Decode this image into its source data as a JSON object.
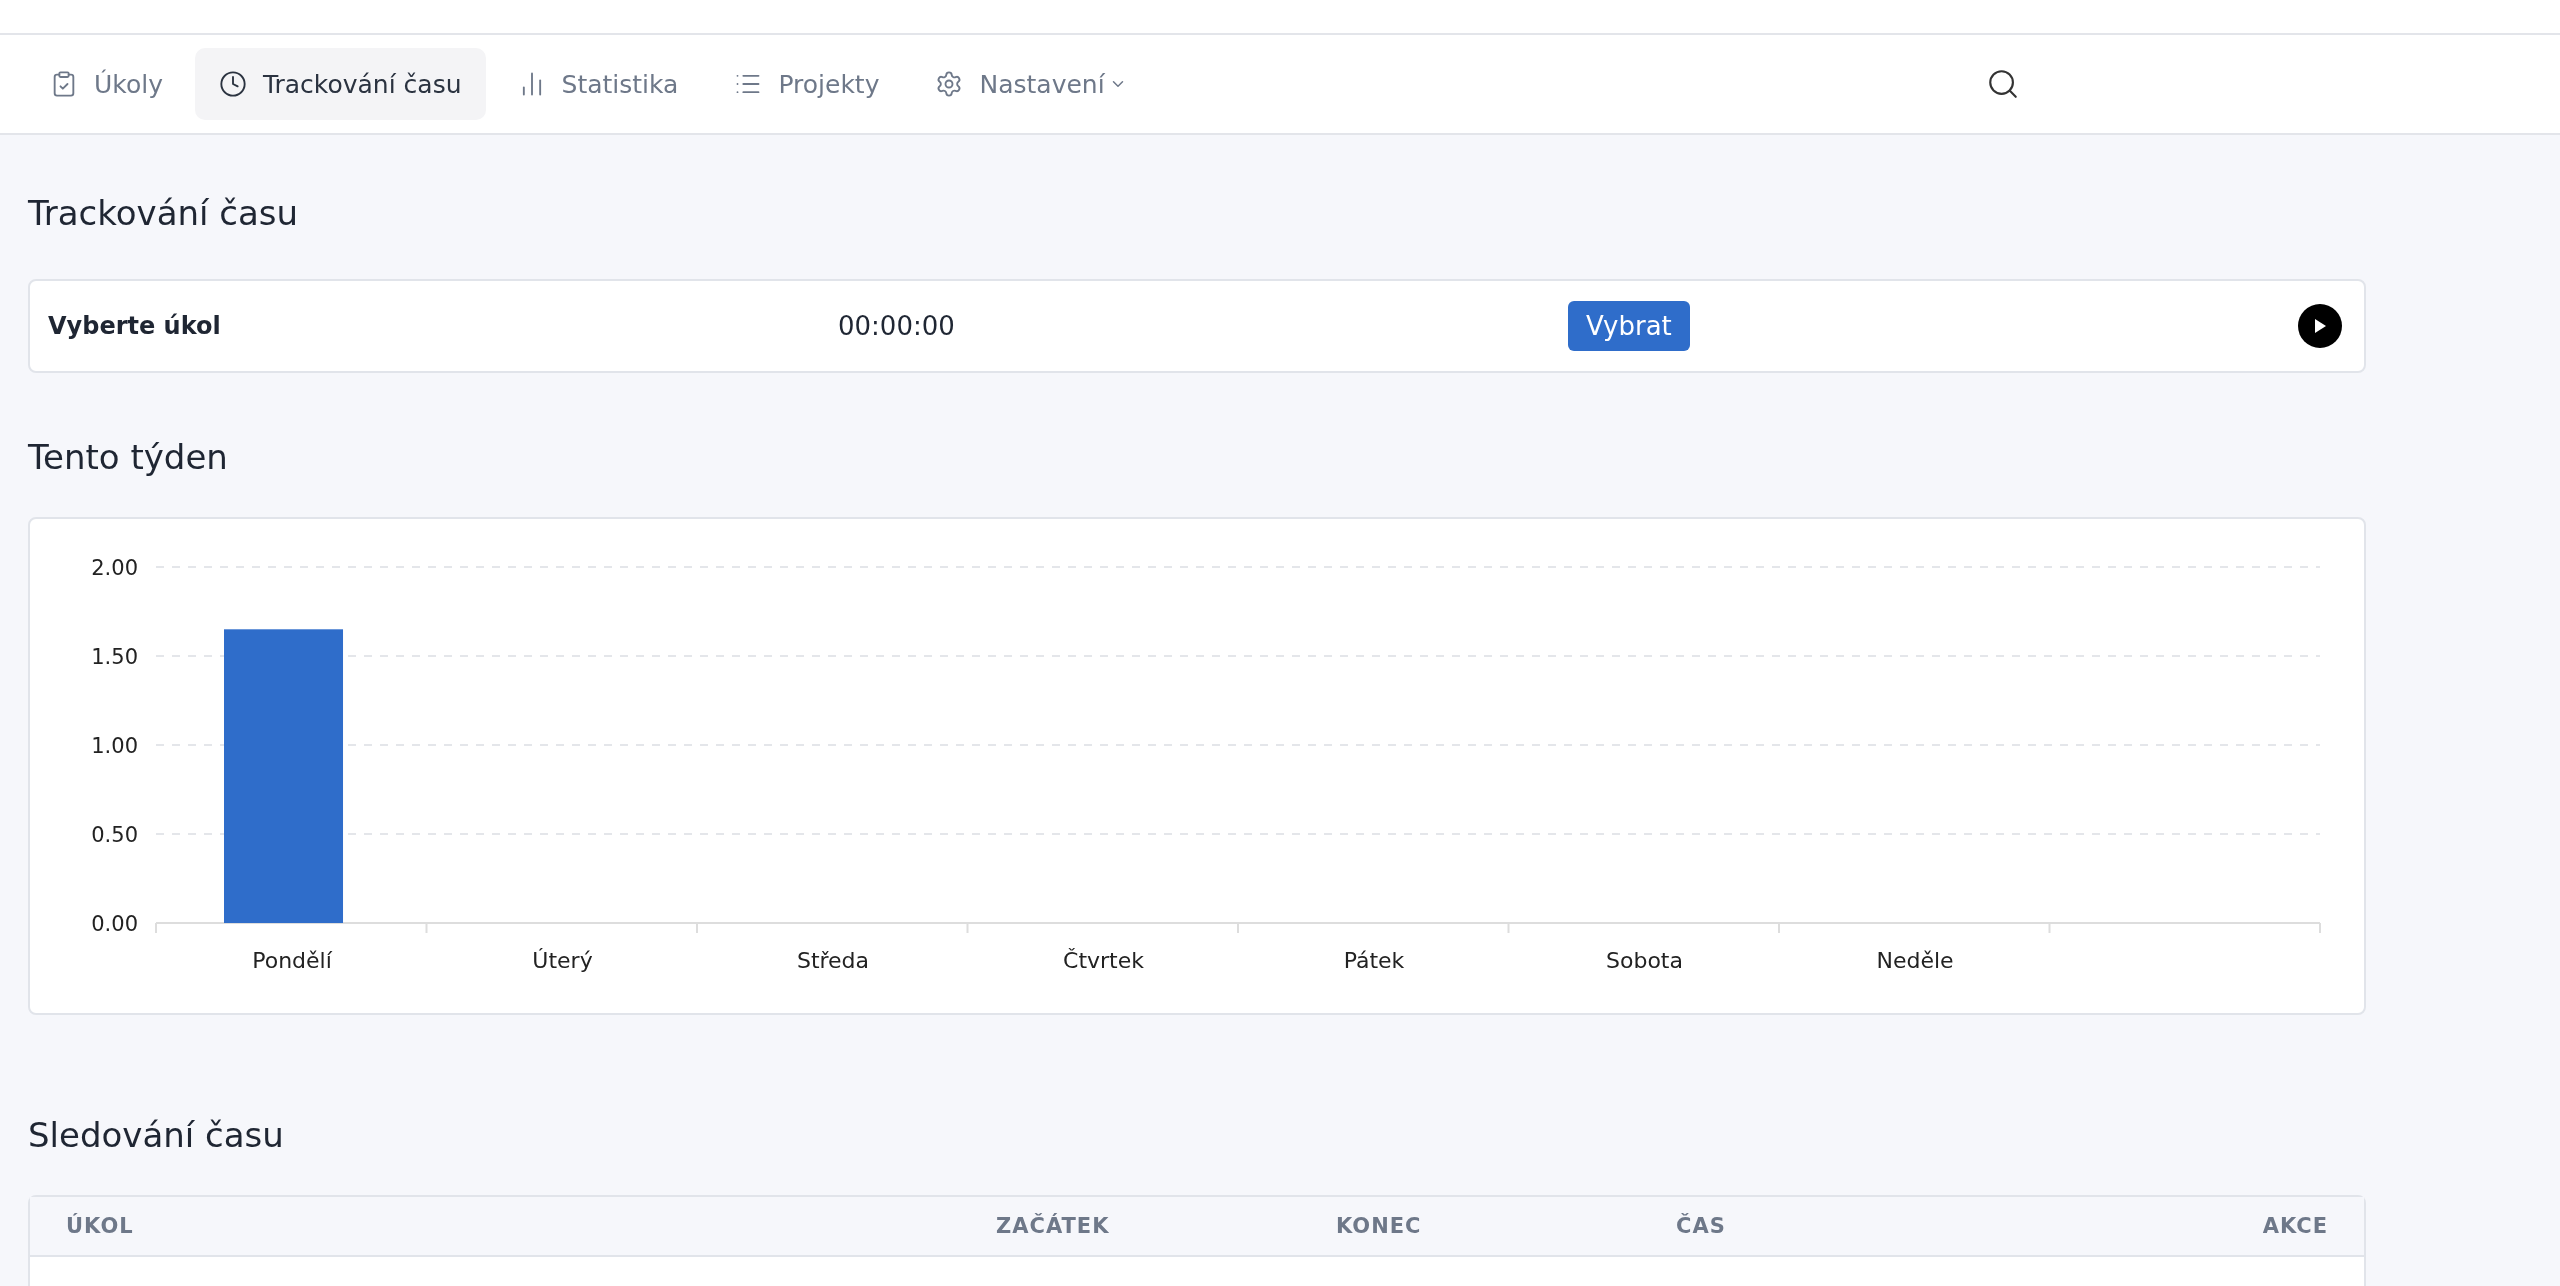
{
  "nav": {
    "items": [
      {
        "label": "Úkoly",
        "selected": false,
        "dropdown": false
      },
      {
        "label": "Trackování času",
        "selected": true,
        "dropdown": false
      },
      {
        "label": "Statistika",
        "selected": false,
        "dropdown": false
      },
      {
        "label": "Projekty",
        "selected": false,
        "dropdown": false
      },
      {
        "label": "Nastavení",
        "selected": false,
        "dropdown": true
      }
    ]
  },
  "page_title": "Trackování času",
  "timer": {
    "task": "Vyberte úkol",
    "time": "00:00:00",
    "button": "Vybrat"
  },
  "week": {
    "title": "Tento týden",
    "chart_data": {
      "type": "bar",
      "grid": true,
      "categories": [
        "Pondělí",
        "Úterý",
        "Středa",
        "Čtvrtek",
        "Pátek",
        "Sobota",
        "Neděle"
      ],
      "series": [
        {
          "color": "#2f6dca",
          "values": [
            1.65,
            0,
            0,
            0,
            0,
            0,
            0
          ]
        }
      ],
      "ylim": [
        0,
        2
      ],
      "yticks": [
        {
          "value": 0,
          "label": "0.00"
        },
        {
          "value": 0.5,
          "label": "0.50"
        },
        {
          "value": 1,
          "label": "1.00"
        },
        {
          "value": 1.5,
          "label": "1.50"
        },
        {
          "value": 2,
          "label": "2.00"
        }
      ]
    }
  },
  "tracking": {
    "title": "Sledování času",
    "columns": [
      "ÚKOL",
      "ZAČÁTEK",
      "KONEC",
      "ČAS",
      "AKCE"
    ]
  }
}
